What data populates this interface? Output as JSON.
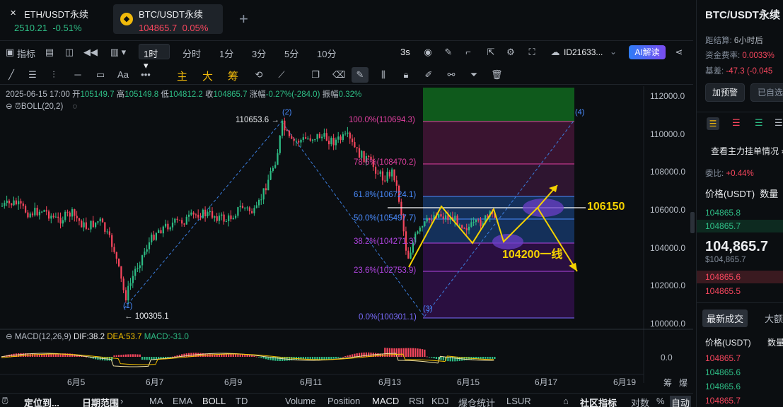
{
  "tabs": [
    {
      "name": "ETH/USDT永续",
      "price": "2510.21",
      "change": "-0.51%"
    },
    {
      "name": "BTC/USDT永续",
      "price": "104865.7",
      "change": "0.05%"
    }
  ],
  "add_tab": "+",
  "toolbar": {
    "indicator": "指标",
    "interval_selected": "1时",
    "intervals": [
      "分时",
      "1分",
      "3分",
      "5分",
      "10分"
    ],
    "refresh": "3s",
    "account": "ID21633...",
    "ai": "AI解读"
  },
  "drawing_tools": {
    "main": "主",
    "big": "大",
    "chip": "筹",
    "text": "Aa"
  },
  "ohlc": {
    "date": "2025-06-15 17:00",
    "open_label": "开",
    "open": "105149.7",
    "high_label": "高",
    "high": "105149.8",
    "low_label": "低",
    "low": "104812.2",
    "close_label": "收",
    "close": "104865.7",
    "change_label": "涨幅",
    "change": "-0.27%(-284.0)",
    "amp_label": "振幅",
    "amp": "0.32%"
  },
  "boll_label": "BOLL(20,2)",
  "price_axis": [
    "112000.0",
    "110000.0",
    "108000.0",
    "106000.0",
    "104000.0",
    "102000.0",
    "100000.0"
  ],
  "date_axis": [
    "6月5",
    "6月7",
    "6月9",
    "6月11",
    "6月13",
    "6月15",
    "6月17",
    "6月19"
  ],
  "fib": [
    {
      "label": "100.0%(110694.3)",
      "color": "#e040a0"
    },
    {
      "label": "78.6%(108470.2)",
      "color": "#e040a0"
    },
    {
      "label": "61.8%(106724.1)",
      "color": "#4a8cff"
    },
    {
      "label": "50.0%(105497.7)",
      "color": "#4a8cff"
    },
    {
      "label": "38.2%(104271.3)",
      "color": "#b044e0"
    },
    {
      "label": "23.6%(102753.9)",
      "color": "#b044e0"
    },
    {
      "label": "0.0%(100301.1)",
      "color": "#7b6cff"
    }
  ],
  "wave_points": {
    "p1": "(1)",
    "p2": "(2)",
    "p3": "(3)",
    "p4": "(4)",
    "high_label": "110653.6",
    "low_label": "← 100305.1"
  },
  "annotations": {
    "level_high": "106150",
    "level_low": "104200一线"
  },
  "macd": {
    "label": "MACD(12,26,9)",
    "dif": "DIF:38.2",
    "dea": "DEA:53.7",
    "macd": "MACD:-31.0",
    "axis": "0.0"
  },
  "bottom_tabs": [
    "定位到...",
    "日期范围",
    "MA",
    "EMA",
    "BOLL",
    "TD",
    "Volume",
    "Position",
    "MACD",
    "RSI",
    "KDJ",
    "爆仓统计",
    "LSUR",
    "社区指标",
    "对数",
    "%",
    "自动"
  ],
  "side_labels": {
    "chip": "筹",
    "explode": "爆"
  },
  "right": {
    "title": "BTC/USDT永续",
    "settle_label": "距结算:",
    "settle": "6小时后",
    "funding_label": "资金费率:",
    "funding": "0.0033%",
    "basis_label": "基差:",
    "basis": "-47.3 (-0.045",
    "add_alert": "加预警",
    "added": "已自选",
    "orderbook_link": "查看主力挂单情况",
    "ratio_label": "委比:",
    "ratio": "+0.44%",
    "price_header": "价格(USDT)",
    "qty_header": "数量",
    "asks": [
      "104865.8",
      "104865.7"
    ],
    "last": "104,865.7",
    "last_usd": "$104,865.7",
    "bids": [
      "104865.6",
      "104865.5"
    ],
    "trades_tab": "最新成交",
    "trades_tab2": "大额",
    "trade_price_header": "价格(USDT)",
    "trade_qty_header": "数量",
    "trades": [
      "104865.7",
      "104865.6",
      "104865.6",
      "104865.7"
    ]
  },
  "colors": {
    "up": "#2ebd85",
    "down": "#f6465d",
    "accent": "#f0b90b",
    "bg": "#0b0e11"
  }
}
